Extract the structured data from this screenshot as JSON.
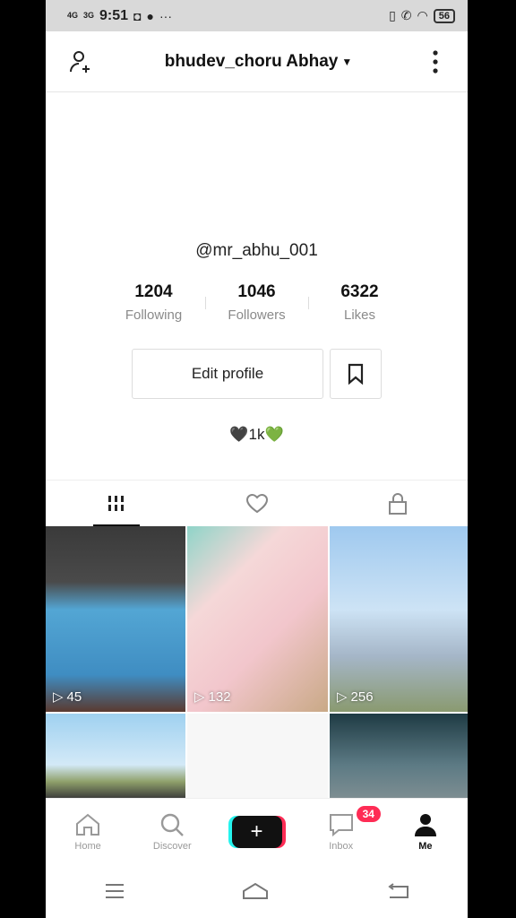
{
  "status_bar": {
    "signal1": "4G",
    "signal2": "3G",
    "time": "9:51",
    "icons_more": "···",
    "battery": "56"
  },
  "header": {
    "title": "bhudev_choru Abhay",
    "add_user_icon": "add-user-icon",
    "more_icon": "more-vertical-icon"
  },
  "profile": {
    "handle": "@mr_abhu_001",
    "stats": [
      {
        "value": "1204",
        "label": "Following"
      },
      {
        "value": "1046",
        "label": "Followers"
      },
      {
        "value": "6322",
        "label": "Likes"
      }
    ],
    "edit_button": "Edit profile",
    "bio_emoji_black": "🖤",
    "bio_text": "1k",
    "bio_emoji_green": "💚"
  },
  "tabs": [
    "videos-grid-icon",
    "liked-heart-icon",
    "private-lock-icon"
  ],
  "videos": [
    {
      "views": "45"
    },
    {
      "views": "132"
    },
    {
      "views": "256"
    },
    {
      "views": ""
    },
    {
      "views": ""
    },
    {
      "views": ""
    }
  ],
  "bottom_nav": [
    {
      "label": "Home",
      "icon": "home-icon"
    },
    {
      "label": "Discover",
      "icon": "search-icon"
    },
    {
      "label": "",
      "icon": "plus-icon"
    },
    {
      "label": "Inbox",
      "icon": "inbox-icon",
      "badge": "34"
    },
    {
      "label": "Me",
      "icon": "profile-icon"
    }
  ],
  "colors": {
    "accent_red": "#fe2c55",
    "accent_cyan": "#25f4ee"
  }
}
